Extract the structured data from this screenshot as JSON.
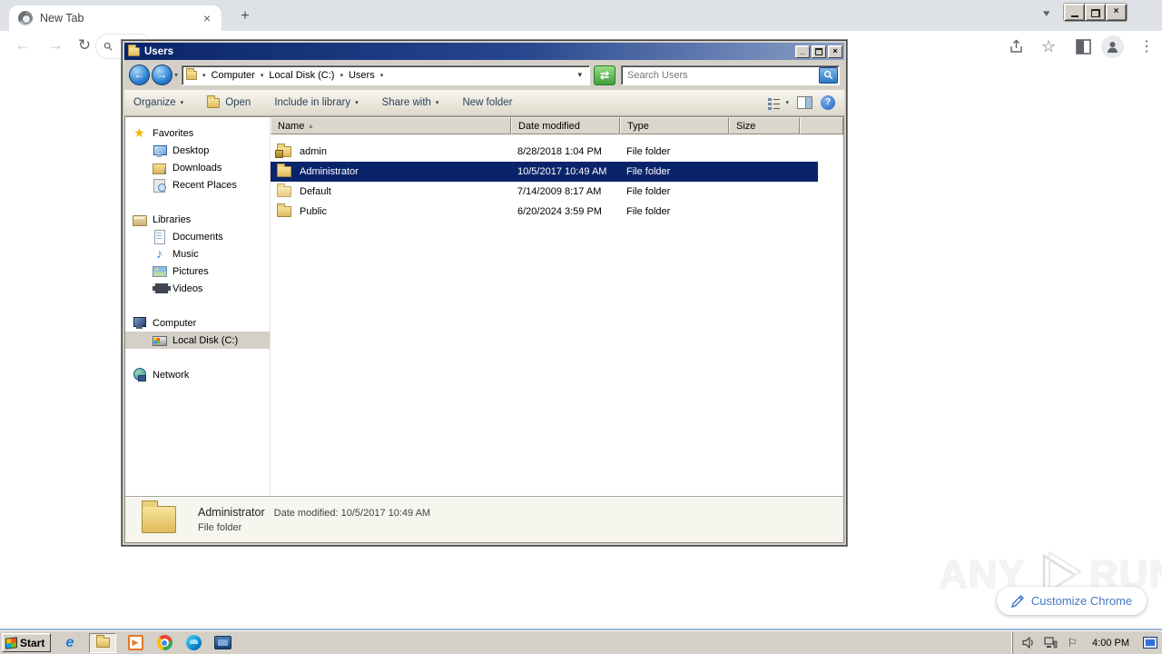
{
  "browser": {
    "tab_title": "New Tab"
  },
  "icons": {
    "close": "×",
    "new_tab": "+",
    "chevron_small": "▾",
    "back_arrow": "←",
    "forward_arrow": "→",
    "reload": "↻",
    "star_outline": "☆",
    "overflow_dots": "⋮",
    "breadcrumb_chevron": "▾",
    "sort_ascending": "▴",
    "favorites_star": "★",
    "music_note": "♪",
    "help": "?",
    "refresh_arrows": "⇄",
    "minimize": "_",
    "ie_logo": "e",
    "tray_flag": "⚐",
    "play": "▶"
  },
  "explorer": {
    "window_title": "Users",
    "breadcrumb": [
      "Computer",
      "Local Disk (C:)",
      "Users"
    ],
    "search_placeholder": "Search Users",
    "commandbar": {
      "organize": "Organize",
      "open": "Open",
      "include_in_library": "Include in library",
      "share_with": "Share with",
      "new_folder": "New folder"
    },
    "sidebar": {
      "favorites": {
        "label": "Favorites",
        "items": [
          "Desktop",
          "Downloads",
          "Recent Places"
        ]
      },
      "libraries": {
        "label": "Libraries",
        "items": [
          "Documents",
          "Music",
          "Pictures",
          "Videos"
        ]
      },
      "computer": {
        "label": "Computer",
        "items": [
          "Local Disk (C:)"
        ]
      },
      "network": {
        "label": "Network"
      }
    },
    "columns": [
      "Name",
      "Date modified",
      "Type",
      "Size"
    ],
    "rows": [
      {
        "name": "admin",
        "date": "8/28/2018 1:04 PM",
        "type": "File folder",
        "selected": false
      },
      {
        "name": "Administrator",
        "date": "10/5/2017 10:49 AM",
        "type": "File folder",
        "selected": true
      },
      {
        "name": "Default",
        "date": "7/14/2009 8:17 AM",
        "type": "File folder",
        "selected": false
      },
      {
        "name": "Public",
        "date": "6/20/2024 3:59 PM",
        "type": "File folder",
        "selected": false
      }
    ],
    "details": {
      "name": "Administrator",
      "date_modified": "Date modified: 10/5/2017 10:49 AM",
      "type": "File folder"
    }
  },
  "overlay": {
    "watermark": {
      "left": "ANY",
      "right": "RUN"
    },
    "customize_button": "Customize Chrome"
  },
  "taskbar": {
    "start_label": "Start",
    "clock": "4:00 PM"
  },
  "colors": {
    "titlebar_gradient_start": "#0a246a",
    "titlebar_gradient_end": "#8ba0c8",
    "selection_background": "#0a246a",
    "classic_gray": "#d4d0c8",
    "tabstrip_gray": "#dee1e6",
    "customize_chrome_blue": "#4579c1",
    "folder_yellow": "#e0ba5c",
    "refresh_green": "#3c9f3c"
  }
}
